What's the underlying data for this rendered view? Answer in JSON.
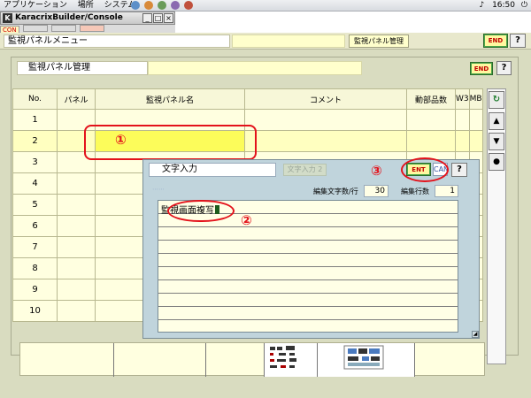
{
  "system_bar": {
    "menus": [
      "アプリケーション",
      "場所",
      "システム"
    ],
    "clock": "16:50"
  },
  "window": {
    "logo": "K",
    "title": "KaracrixBuilder/Console",
    "tabs": [
      "CON",
      "",
      "",
      ""
    ]
  },
  "app_header": {
    "title": "監視パネルメニュー",
    "screen_label": "監視パネル管理",
    "end_label": "END",
    "help_label": "?"
  },
  "panel": {
    "title": "監視パネル管理",
    "end_label": "END",
    "help_label": "?"
  },
  "table": {
    "columns": [
      "No.",
      "パネル",
      "監視パネル名",
      "コメント",
      "動部品数",
      "W3",
      "MB"
    ],
    "rows": [
      "1",
      "2",
      "3",
      "4",
      "5",
      "6",
      "7",
      "8",
      "9",
      "10"
    ],
    "selected_row": "2"
  },
  "scroll": {
    "refresh_icon": "refresh-icon",
    "up_icon": "triangle-up-icon",
    "down_icon": "triangle-down-icon",
    "dot_icon": "circle-icon"
  },
  "dialog": {
    "title": "文字入力",
    "mode_button": "文字入力 2",
    "ent_label": "ENT",
    "can_label": "CAN",
    "help_label": "?",
    "chars_per_line_label": "編集文字数/行",
    "chars_per_line": "30",
    "line_count_label": "編集行数",
    "line_count": "1",
    "input_text": "監視画面複写"
  },
  "annotations": {
    "mark1": "①",
    "mark2": "②",
    "mark3": "③"
  },
  "colors": {
    "annotation": "#e3121b",
    "selected_cell": "#fcfc5a",
    "app_background": "#d9dcc0",
    "dialog_background": "#c0d4dc"
  }
}
